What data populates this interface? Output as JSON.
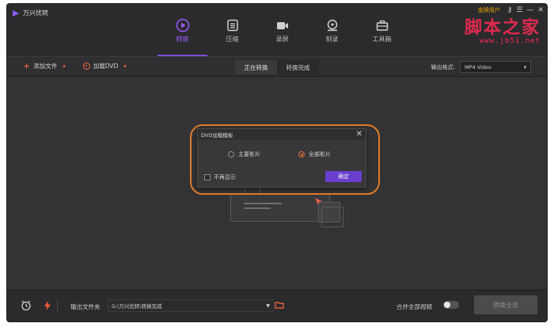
{
  "app": {
    "title": "万兴优转"
  },
  "nav": {
    "items": [
      {
        "label": "转换",
        "icon": "convert-icon"
      },
      {
        "label": "压缩",
        "icon": "compress-icon"
      },
      {
        "label": "录屏",
        "icon": "record-screen-icon"
      },
      {
        "label": "刻录",
        "icon": "burn-icon"
      },
      {
        "label": "工具箱",
        "icon": "toolbox-icon"
      }
    ],
    "active_index": 0
  },
  "window": {
    "tiny_label": "金牌用户",
    "controls": [
      "key-icon",
      "menu-icon",
      "minimize-icon",
      "close-icon"
    ]
  },
  "watermark": {
    "text": "脚本之家",
    "url": "www.jb51.net"
  },
  "toolbar": {
    "add_file": "添加文件",
    "load_dvd": "加载DVD",
    "tabs": [
      "正在转换",
      "转换完成"
    ],
    "output_format_label": "输出格式:",
    "output_format_value": "MP4 Video"
  },
  "dialog": {
    "title": "DVD加载模板",
    "option_main": "主要影片",
    "option_all": "全部影片",
    "selected": "全部影片",
    "dont_show": "不再显示",
    "ok": "确定"
  },
  "footer": {
    "output_folder_label": "输出文件夹",
    "output_path": "G:\\万兴优转\\转换完成",
    "merge_label": "合并全部视频",
    "merge_enabled": false,
    "convert_all": "转换全部"
  },
  "colors": {
    "accent": "#7a4cd8",
    "orange": "#ff6a3d",
    "highlight": "#e07c2a",
    "watermark": "#ff2a55"
  }
}
